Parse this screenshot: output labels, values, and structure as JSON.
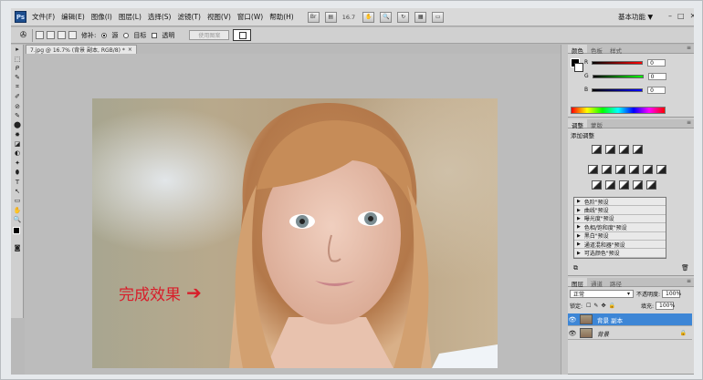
{
  "menubar": {
    "logo": "Ps",
    "items": [
      "文件(F)",
      "编辑(E)",
      "图像(I)",
      "图层(L)",
      "选择(S)",
      "滤镜(T)",
      "视图(V)",
      "窗口(W)",
      "帮助(H)"
    ],
    "zoom": "16.7",
    "workspace": "基本功能",
    "workspace_arrow": "▼",
    "win_controls": [
      "–",
      "□",
      "✕"
    ]
  },
  "options": {
    "patch_label": "修补:",
    "source_label": "源",
    "target_label": "目标",
    "transparent_label": "透明",
    "use_pattern_button": "使用图案"
  },
  "toolbox": {
    "tools": [
      "▸",
      "⬚",
      "ᑭ",
      "✎",
      "⌗",
      "✐",
      "⊘",
      "✎",
      "⬤",
      "✸",
      "◪",
      "◐",
      "✦",
      "⬮",
      "T",
      "↖",
      "▭",
      "✋",
      "🔍"
    ],
    "quickmask": "◙"
  },
  "document": {
    "tab_title": "7.jpg @ 16.7% (背景 副本, RGB/8) *",
    "tab_close": "×",
    "caption": "完成效果",
    "caption_arrow": "➔"
  },
  "color_panel": {
    "tabs": [
      "颜色",
      "色板",
      "样式"
    ],
    "rows": [
      {
        "label": "R",
        "value": "0",
        "gradient": "linear-gradient(90deg,#000,#f00)"
      },
      {
        "label": "G",
        "value": "0",
        "gradient": "linear-gradient(90deg,#000,#0f0)"
      },
      {
        "label": "B",
        "value": "0",
        "gradient": "linear-gradient(90deg,#000,#00f)"
      }
    ]
  },
  "adjust_panel": {
    "tabs": [
      "调整",
      "蒙版"
    ],
    "title": "添加调整",
    "presets": [
      "色阶\"预设",
      "曲线\"预设",
      "曝光度\"预设",
      "色相/饱和度\"预设",
      "黑白\"预设",
      "通道混和器\"预设",
      "可选颜色\"预设"
    ]
  },
  "layers_panel": {
    "tabs": [
      "图层",
      "通道",
      "路径"
    ],
    "blend_mode": "正常",
    "opacity_label": "不透明度:",
    "opacity_value": "100%",
    "lock_label": "锁定:",
    "fill_label": "填充:",
    "fill_value": "100%",
    "layers": [
      {
        "name": "背景 副本",
        "selected": true
      },
      {
        "name": "背景",
        "selected": false
      }
    ]
  },
  "colors": {
    "accent": "#3d86d6",
    "caption": "#d81e2a",
    "ps_logo": "#1e4f8f"
  }
}
